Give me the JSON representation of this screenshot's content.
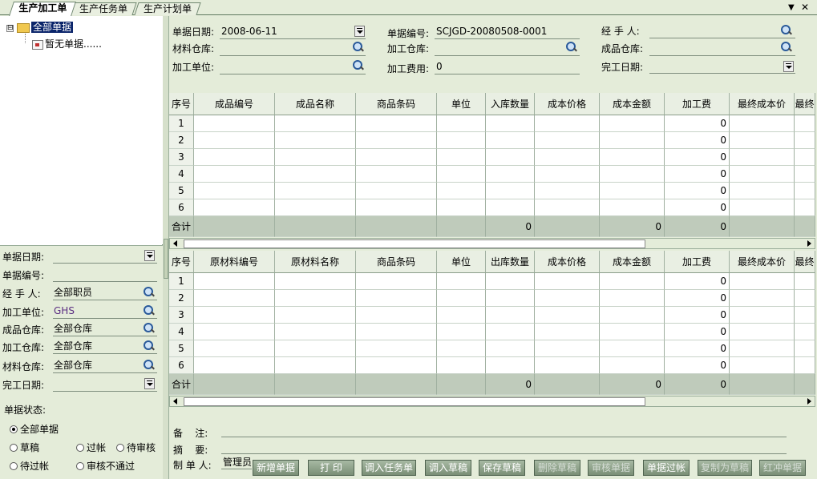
{
  "tabs": [
    {
      "label": "生产加工单",
      "active": true
    },
    {
      "label": "生产任务单",
      "active": false
    },
    {
      "label": "生产计划单",
      "active": false
    }
  ],
  "window_controls": {
    "menu": "▼",
    "close": "✕"
  },
  "tree": {
    "expander": "⊟",
    "root": "全部单据",
    "child": "暂无单据......"
  },
  "filters": {
    "date_label": "单据日期:",
    "date_value": "",
    "no_label": "单据编号:",
    "no_value": "",
    "handler_label": "经 手 人:",
    "handler_value": "全部职员",
    "unit_label": "加工单位:",
    "unit_value": "GHS",
    "product_wh_label": "成品仓库:",
    "product_wh_value": "全部仓库",
    "process_wh_label": "加工仓库:",
    "process_wh_value": "全部仓库",
    "material_wh_label": "材料仓库:",
    "material_wh_value": "全部仓库",
    "finish_label": "完工日期:",
    "finish_value": "",
    "status_label": "单据状态:",
    "status_options": [
      "全部单据",
      "草稿",
      "过帐",
      "待审核",
      "待过帐",
      "审核不通过"
    ],
    "status_selected": "全部单据"
  },
  "header": {
    "date_label": "单据日期:",
    "date_value": "2008-06-11",
    "no_label": "单据编号:",
    "no_value": "SCJGD-20080508-0001",
    "handler_label": "经 手 人:",
    "handler_value": "",
    "material_wh_label": "材料仓库:",
    "material_wh_value": "",
    "process_wh_label": "加工仓库:",
    "process_wh_value": "",
    "product_wh_label": "成品仓库:",
    "product_wh_value": "",
    "unit_label": "加工单位:",
    "unit_value": "",
    "fee_label": "加工费用:",
    "fee_value": "0",
    "finish_label": "完工日期:",
    "finish_value": ""
  },
  "product_grid": {
    "columns": [
      "序号",
      "成品编号",
      "成品名称",
      "商品条码",
      "单位",
      "入库数量",
      "成本价格",
      "成本金额",
      "加工费",
      "最终成本价",
      "最终"
    ],
    "rows": [
      {
        "no": "1",
        "fee": "0"
      },
      {
        "no": "2",
        "fee": "0"
      },
      {
        "no": "3",
        "fee": "0"
      },
      {
        "no": "4",
        "fee": "0"
      },
      {
        "no": "5",
        "fee": "0"
      },
      {
        "no": "6",
        "fee": "0"
      }
    ],
    "total_label": "合计",
    "total_qty": "0",
    "total_amount": "0",
    "total_fee": "0"
  },
  "material_grid": {
    "columns": [
      "序号",
      "原材料编号",
      "原材料名称",
      "商品条码",
      "单位",
      "出库数量",
      "成本价格",
      "成本金额",
      "加工费",
      "最终成本价",
      "最终"
    ],
    "rows": [
      {
        "no": "1",
        "fee": "0"
      },
      {
        "no": "2",
        "fee": "0"
      },
      {
        "no": "3",
        "fee": "0"
      },
      {
        "no": "4",
        "fee": "0"
      },
      {
        "no": "5",
        "fee": "0"
      },
      {
        "no": "6",
        "fee": "0"
      }
    ],
    "total_label": "合计",
    "total_qty": "0",
    "total_amount": "0",
    "total_fee": "0"
  },
  "footer": {
    "remark_label": "备    注:",
    "remark_value": "",
    "summary_label": "摘    要:",
    "summary_value": "",
    "maker_label": "制 单 人:",
    "maker_value": "管理员"
  },
  "buttons": [
    "新增单据",
    "打 印",
    "调入任务单",
    "调入草稿",
    "保存草稿",
    "删除草稿",
    "审核单据",
    "单据过帐",
    "复制为草稿",
    "红冲单据"
  ]
}
